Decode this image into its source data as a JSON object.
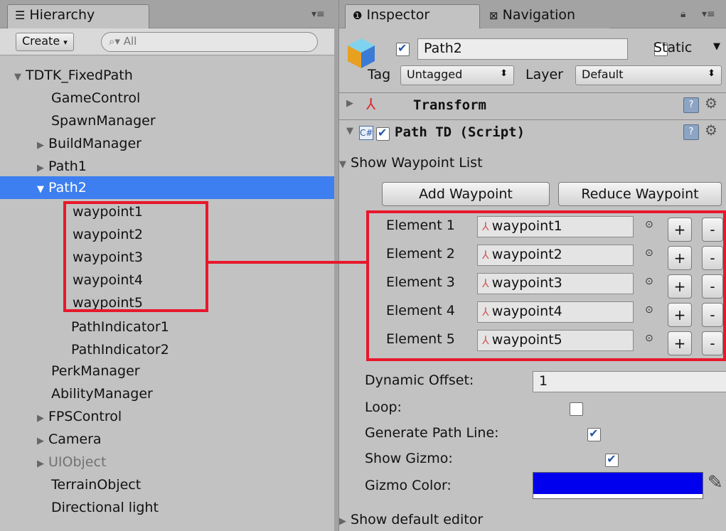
{
  "hierarchy": {
    "tab_label": "Hierarchy",
    "create_label": "Create",
    "search_placeholder": "All",
    "items": [
      "TDTK_FixedPath",
      "GameControl",
      "SpawnManager",
      "BuildManager",
      "Path1",
      "Path2",
      "waypoint1",
      "waypoint2",
      "waypoint3",
      "waypoint4",
      "waypoint5",
      "PathIndicator1",
      "PathIndicator2",
      "PerkManager",
      "AbilityManager",
      "FPSControl",
      "Camera",
      "UIObject",
      "TerrainObject",
      "Directional light"
    ]
  },
  "inspector": {
    "tab_inspector": "Inspector",
    "tab_navigation": "Navigation",
    "object_name": "Path2",
    "static_label": "Static",
    "tag_label": "Tag",
    "tag_value": "Untagged",
    "layer_label": "Layer",
    "layer_value": "Default",
    "transform_title": "Transform",
    "script_title": "Path TD (Script)",
    "show_waypoint_list": "Show Waypoint List",
    "add_waypoint": "Add Waypoint",
    "reduce_waypoint": "Reduce Waypoint",
    "elements": [
      {
        "label": "Element 1",
        "value": "waypoint1"
      },
      {
        "label": "Element 2",
        "value": "waypoint2"
      },
      {
        "label": "Element 3",
        "value": "waypoint3"
      },
      {
        "label": "Element 4",
        "value": "waypoint4"
      },
      {
        "label": "Element 5",
        "value": "waypoint5"
      }
    ],
    "plus_label": "+",
    "minus_label": "-",
    "dynamic_offset_label": "Dynamic Offset:",
    "dynamic_offset_value": "1",
    "loop_label": "Loop:",
    "loop_checked": false,
    "generate_path_line_label": "Generate Path Line:",
    "generate_path_line_checked": true,
    "show_gizmo_label": "Show Gizmo:",
    "show_gizmo_checked": true,
    "gizmo_color_label": "Gizmo Color:",
    "gizmo_color": "#0000ee",
    "show_default_editor": "Show default editor"
  },
  "colors": {
    "selection": "#3d7ff0",
    "highlight": "#e8172b"
  }
}
